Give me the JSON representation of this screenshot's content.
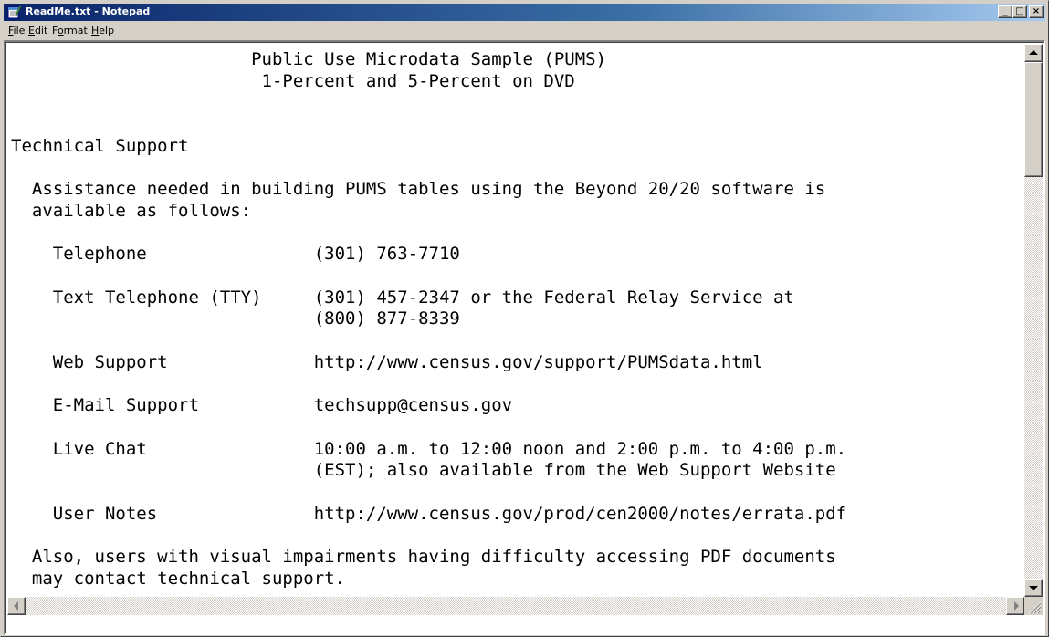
{
  "window": {
    "title": "ReadMe.txt - Notepad",
    "controls": {
      "minimize": "_",
      "maximize": "□",
      "close": "×"
    },
    "colors": {
      "titlebar_start": "#0a246a",
      "titlebar_end": "#a6caf0",
      "chrome": "#d4d0c8"
    }
  },
  "menu": {
    "items": [
      {
        "mnemonic": "F",
        "rest": "ile"
      },
      {
        "mnemonic": "E",
        "rest": "dit"
      },
      {
        "pre": "F",
        "mnemonic": "o",
        "rest": "rmat"
      },
      {
        "mnemonic": "H",
        "rest": "elp"
      }
    ]
  },
  "document": {
    "lines": [
      "                       Public Use Microdata Sample (PUMS)",
      "                        1-Percent and 5-Percent on DVD",
      "",
      "",
      "Technical Support",
      "",
      "  Assistance needed in building PUMS tables using the Beyond 20/20 software is",
      "  available as follows:",
      "",
      "    Telephone                (301) 763-7710",
      "",
      "    Text Telephone (TTY)     (301) 457-2347 or the Federal Relay Service at",
      "                             (800) 877-8339",
      "",
      "    Web Support              http://www.census.gov/support/PUMSdata.html",
      "",
      "    E-Mail Support           techsupp@census.gov",
      "",
      "    Live Chat                10:00 a.m. to 12:00 noon and 2:00 p.m. to 4:00 p.m.",
      "                             (EST); also available from the Web Support Website",
      "",
      "    User Notes               http://www.census.gov/prod/cen2000/notes/errata.pdf",
      "",
      "  Also, users with visual impairments having difficulty accessing PDF documents",
      "  may contact technical support.",
      ""
    ]
  }
}
